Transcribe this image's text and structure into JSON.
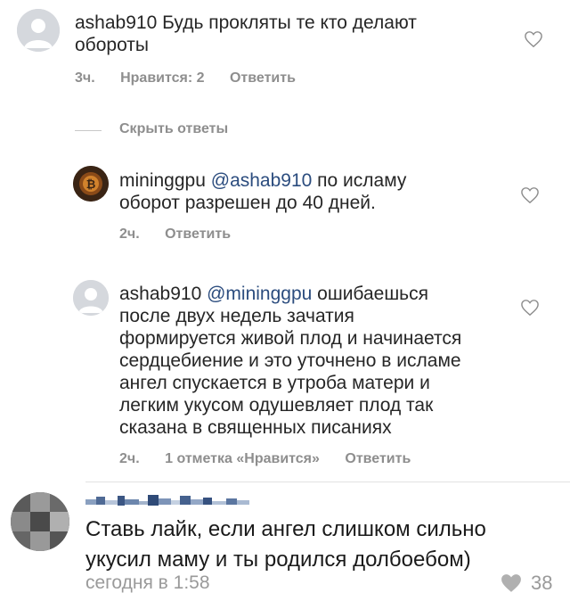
{
  "comments": [
    {
      "username": "ashab910",
      "text": "Будь прокляты те кто делают обороты",
      "text_line1": "Будь прокляты те кто делают",
      "text_line2": "обороты",
      "time": "3ч.",
      "likes": "Нравится: 2",
      "reply": "Ответить"
    },
    {
      "username": "mininggpu",
      "mention": "@ashab910",
      "text_line1_rest": "по исламу",
      "text_line2": "оборот разрешен до 40 дней.",
      "time": "2ч.",
      "reply": "Ответить"
    },
    {
      "username": "ashab910",
      "mention": "@mininggpu",
      "text_line1_rest": "ошибаешься",
      "lines": [
        "после двух недель зачатия",
        "формируется живой плод и начинается",
        "сердцебиение и это уточнено в исламе",
        "ангел спускается в утроба матери и",
        "легким укусом одушевляет плод так",
        "сказана в священных писаниях"
      ],
      "time": "2ч.",
      "likes": "1 отметка «Нравится»",
      "reply": "Ответить"
    }
  ],
  "hide_replies": "Скрыть ответы",
  "vk_comment": {
    "line1": "Ставь лайк, если ангел слишком сильно",
    "line2": "укусил маму и ты родился долбоебом)",
    "time": "сегодня в 1:58",
    "likes": "38"
  },
  "icons": [
    "heart-outline-icon",
    "heart-filled-icon",
    "avatar-placeholder-icon"
  ],
  "colors": {
    "mention": "#2b4c7e",
    "meta": "#8e8e8e",
    "heart_filled": "#b0b0b0"
  }
}
